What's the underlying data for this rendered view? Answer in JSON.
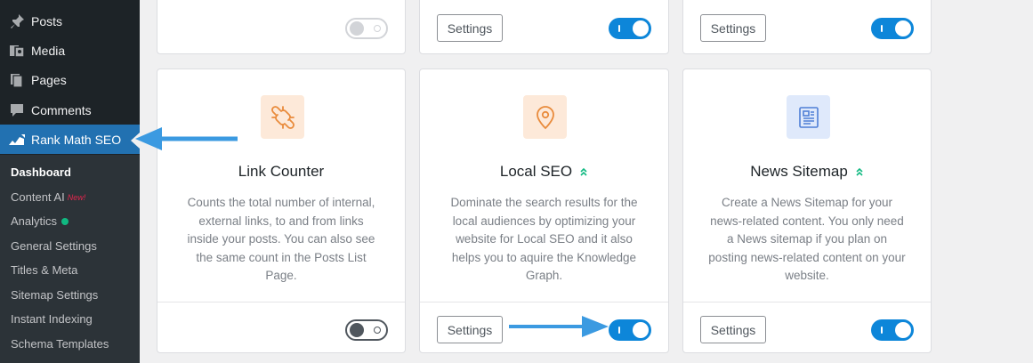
{
  "sidebar": {
    "menu": [
      {
        "label": "Posts",
        "icon": "pin-icon"
      },
      {
        "label": "Media",
        "icon": "media-icon"
      },
      {
        "label": "Pages",
        "icon": "pages-icon"
      },
      {
        "label": "Comments",
        "icon": "comment-icon"
      },
      {
        "label": "Rank Math SEO",
        "icon": "rank-math-icon",
        "active": true
      }
    ],
    "submenu": [
      {
        "label": "Dashboard",
        "current": true
      },
      {
        "label": "Content AI",
        "badge": "New!"
      },
      {
        "label": "Analytics",
        "status_dot": "#10b981"
      },
      {
        "label": "General Settings"
      },
      {
        "label": "Titles & Meta"
      },
      {
        "label": "Sitemap Settings"
      },
      {
        "label": "Instant Indexing"
      },
      {
        "label": "Schema Templates"
      }
    ]
  },
  "top_row": [
    {
      "settings_label": "",
      "toggle": "off"
    },
    {
      "settings_label": "Settings",
      "toggle": "on"
    },
    {
      "settings_label": "Settings",
      "toggle": "on"
    }
  ],
  "modules": [
    {
      "title": "Link Counter",
      "icon": "broken-link-icon",
      "description": "Counts the total number of internal, external links, to and from links inside your posts. You can also see the same count in the Posts List Page.",
      "settings_label": "",
      "toggle": "off"
    },
    {
      "title": "Local SEO",
      "icon": "location-pin-icon",
      "badge": "double-chevron-up-icon",
      "description": "Dominate the search results for the local audiences by optimizing your website for Local SEO and it also helps you to aquire the Knowledge Graph.",
      "settings_label": "Settings",
      "toggle": "on"
    },
    {
      "title": "News Sitemap",
      "icon": "news-icon",
      "badge": "double-chevron-up-icon",
      "description": "Create a News Sitemap for your news-related content. You only need a News sitemap if you plan on posting news-related content on your website.",
      "settings_label": "Settings",
      "toggle": "on"
    }
  ],
  "colors": {
    "sidebar_bg": "#1d2327",
    "active_menu": "#2271b1",
    "toggle_on": "#0d86d9",
    "annotation_arrow": "#3b9ae1",
    "pro_chevron": "#10b981"
  }
}
